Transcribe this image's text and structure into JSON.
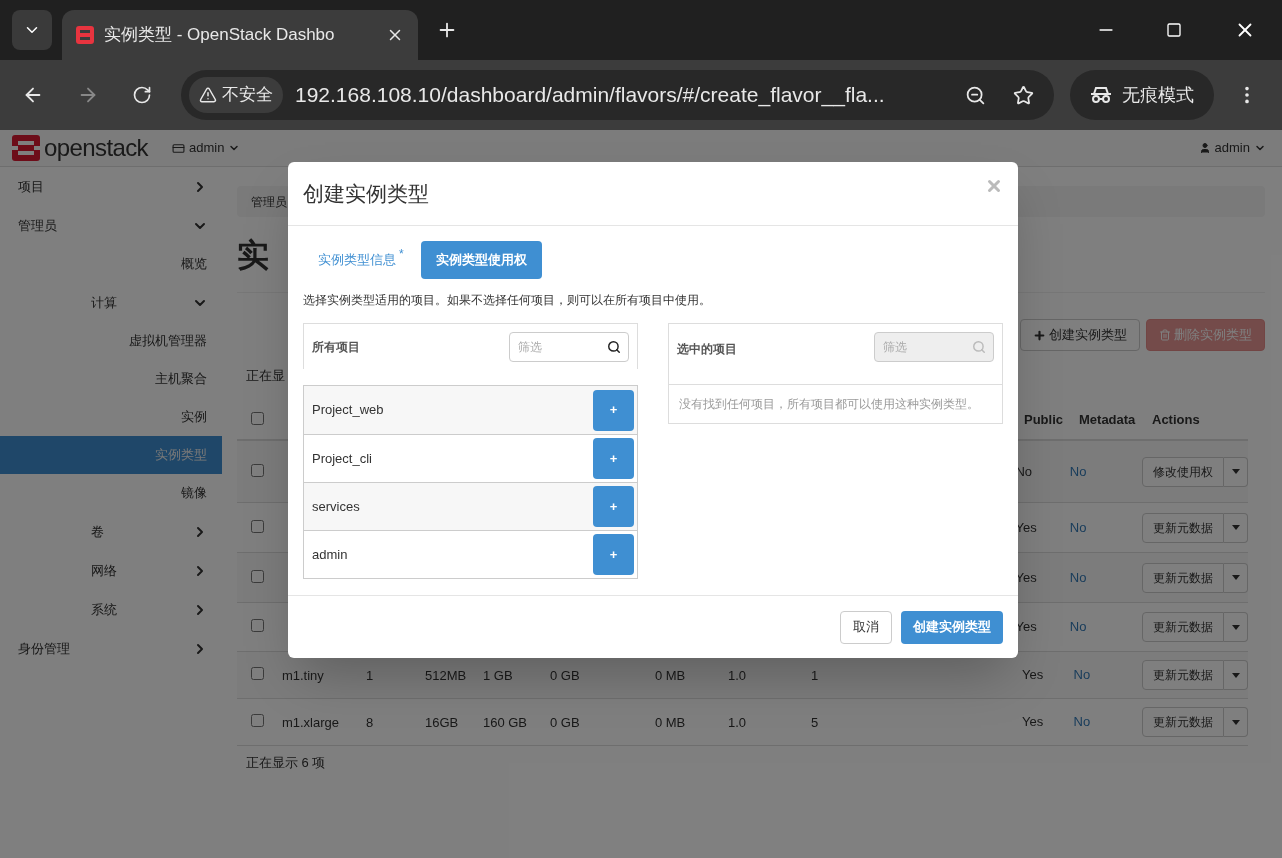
{
  "browser": {
    "tab_title": "实例类型 - OpenStack Dashbo",
    "security": "不安全",
    "url": "192.168.108.10/dashboard/admin/flavors/#/create_flavor__fla...",
    "incognito": "无痕模式"
  },
  "header": {
    "logo": "openstack",
    "project": "admin",
    "user": "admin"
  },
  "sidebar": [
    {
      "label": "项目",
      "expanded": false
    },
    {
      "label": "管理员",
      "expanded": true,
      "children": [
        {
          "label": "概览",
          "selected": false
        },
        {
          "label": "计算",
          "expanded": true,
          "children": [
            {
              "label": "虚拟机管理器",
              "selected": false
            },
            {
              "label": "主机聚合",
              "selected": false
            },
            {
              "label": "实例",
              "selected": false
            },
            {
              "label": "实例类型",
              "selected": true
            },
            {
              "label": "镜像",
              "selected": false
            }
          ]
        },
        {
          "label": "卷",
          "expanded": false
        },
        {
          "label": "网络",
          "expanded": false
        },
        {
          "label": "系统",
          "expanded": false
        }
      ]
    },
    {
      "label": "身份管理",
      "expanded": false
    }
  ],
  "page": {
    "breadcrumb": "管理员",
    "heading": "实",
    "summary_top": "正在显",
    "toolbar": [
      {
        "kind": "create",
        "label": "创建实例类型",
        "disabled": false
      },
      {
        "kind": "delete",
        "label": "删除实例类型",
        "disabled": true
      }
    ],
    "select_all_checked": false,
    "columns": [
      "Public",
      "Metadata",
      "Actions"
    ],
    "rows": [
      {
        "checked": false,
        "public": "No",
        "metadata": "No",
        "action": "修改使用权"
      },
      {
        "checked": false,
        "public": "Yes",
        "metadata": "No",
        "action": "更新元数据"
      },
      {
        "checked": false,
        "public": "Yes",
        "metadata": "No",
        "action": "更新元数据"
      },
      {
        "checked": false,
        "public": "Yes",
        "metadata": "No",
        "action": "更新元数据"
      },
      {
        "checked": false,
        "cells": [
          "m1.tiny",
          "1",
          "512MB",
          "1 GB",
          "0 GB",
          "0 MB",
          "1.0",
          "1"
        ],
        "public": "Yes",
        "metadata": "No",
        "action": "更新元数据"
      },
      {
        "checked": false,
        "cells": [
          "m1.xlarge",
          "8",
          "16GB",
          "160 GB",
          "0 GB",
          "0 MB",
          "1.0",
          "5"
        ],
        "public": "Yes",
        "metadata": "No",
        "action": "更新元数据"
      }
    ],
    "footer": "正在显示 6 项"
  },
  "modal": {
    "title": "创建实例类型",
    "tabs": [
      {
        "label": "实例类型信息",
        "marker": "*",
        "selected": false
      },
      {
        "label": "实例类型使用权",
        "selected": true
      }
    ],
    "help": "选择实例类型适用的项目。如果不选择任何项目，则可以在所有项目中使用。",
    "all_projects": {
      "title": "所有项目",
      "filter_placeholder": "筛选",
      "filter_disabled": false,
      "items": [
        {
          "name": "Project_web",
          "add": "+"
        },
        {
          "name": "Project_cli",
          "add": "+"
        },
        {
          "name": "services",
          "add": "+"
        },
        {
          "name": "admin",
          "add": "+"
        }
      ]
    },
    "selected_projects": {
      "title": "选中的项目",
      "filter_placeholder": "筛选",
      "filter_disabled": true,
      "empty_message": "没有找到任何项目，所有项目都可以使用这种实例类型。"
    },
    "cancel": "取消",
    "submit": "创建实例类型"
  }
}
